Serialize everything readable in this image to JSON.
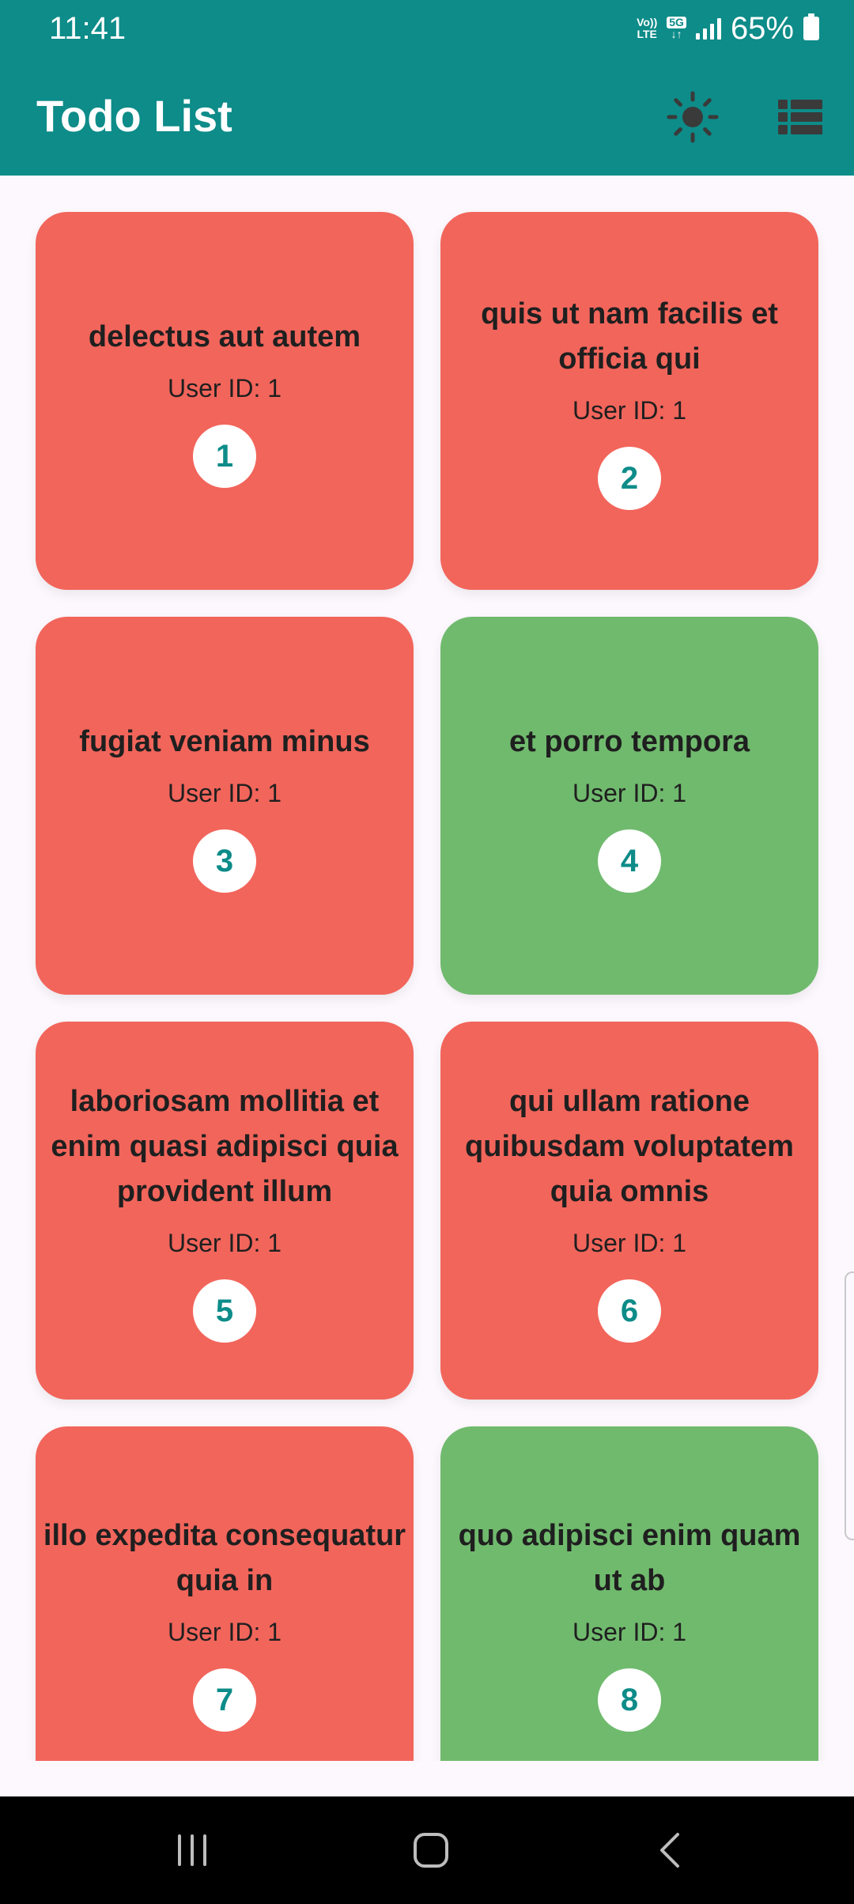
{
  "status_bar": {
    "time": "11:41",
    "volte_top": "Vo))",
    "volte_bottom": "LTE",
    "network": "5G",
    "battery": "65%"
  },
  "app_bar": {
    "title": "Todo List",
    "theme_icon": "sun-icon",
    "view_icon": "list-view-icon"
  },
  "colors": {
    "primary": "#0D8C89",
    "incomplete": "#F2655B",
    "completed": "#70BA6E",
    "background": "#FCF8FD"
  },
  "todos": [
    {
      "id": "1",
      "title": "delectus aut autem",
      "user": "User ID: 1",
      "completed": false
    },
    {
      "id": "2",
      "title": "quis ut nam facilis et officia qui",
      "user": "User ID: 1",
      "completed": false
    },
    {
      "id": "3",
      "title": "fugiat veniam minus",
      "user": "User ID: 1",
      "completed": false
    },
    {
      "id": "4",
      "title": "et porro tempora",
      "user": "User ID: 1",
      "completed": true
    },
    {
      "id": "5",
      "title": "laboriosam mollitia et enim quasi adipisci quia provident illum",
      "user": "User ID: 1",
      "completed": false
    },
    {
      "id": "6",
      "title": "qui ullam ratione quibusdam voluptatem quia omnis",
      "user": "User ID: 1",
      "completed": false
    },
    {
      "id": "7",
      "title": "illo expedita consequatur quia in",
      "user": "User ID: 1",
      "completed": false
    },
    {
      "id": "8",
      "title": "quo adipisci enim quam ut ab",
      "user": "User ID: 1",
      "completed": true
    }
  ],
  "nav_bar": {
    "recents_icon": "recents-icon",
    "home_icon": "home-icon",
    "back_icon": "back-icon"
  }
}
